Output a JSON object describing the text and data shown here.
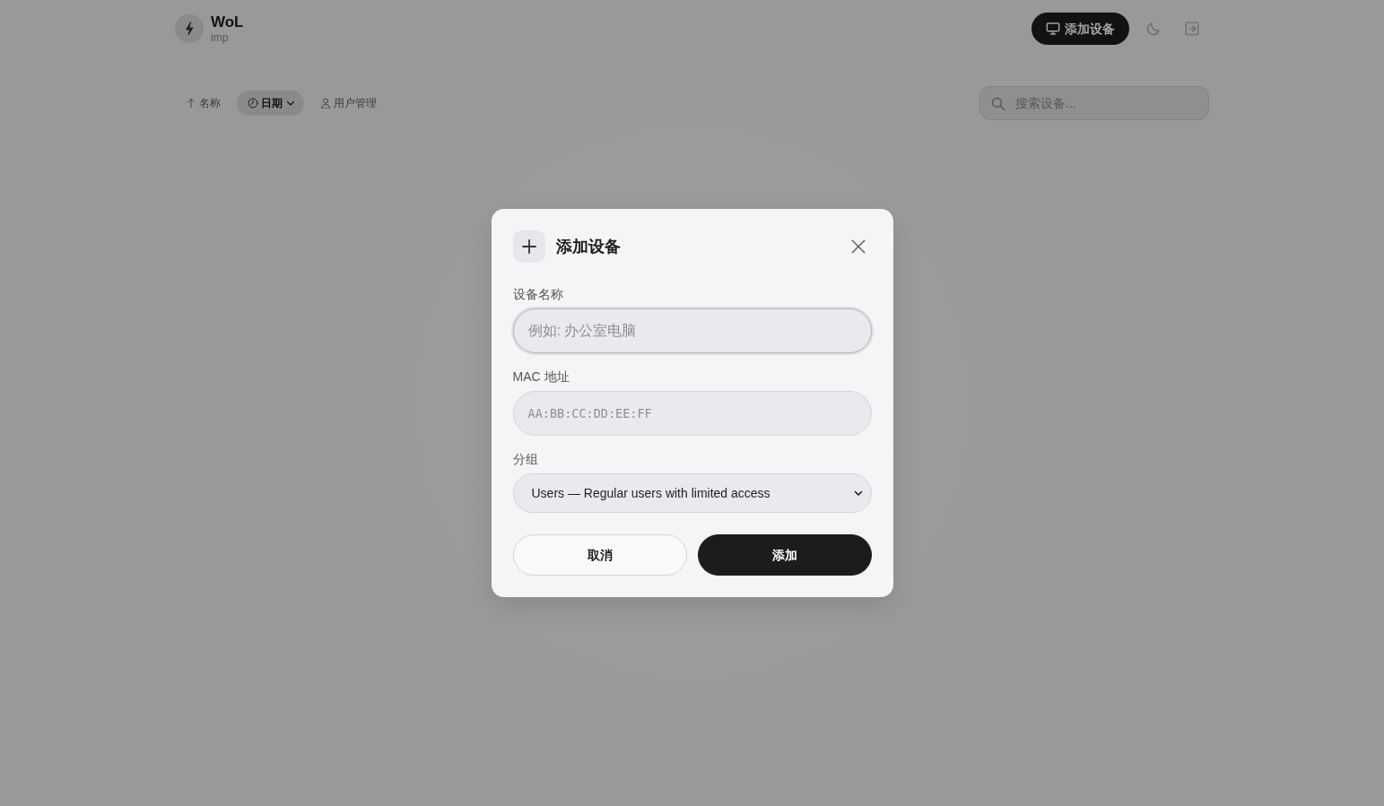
{
  "header": {
    "app_name": "WoL",
    "user": "imp",
    "add_device_button": "添加设备"
  },
  "toolbar": {
    "items": [
      {
        "kind": "name",
        "label": "名称",
        "selected": false
      },
      {
        "kind": "date",
        "label": "日期",
        "selected": true
      },
      {
        "kind": "users",
        "label": "用户管理",
        "selected": false
      }
    ],
    "search": {
      "placeholder": "搜索设备..."
    }
  },
  "dialog": {
    "title": "添加设备",
    "fields": [
      {
        "kind": "text",
        "label": "设备名称",
        "placeholder": "例如: 办公室电脑",
        "focused": true
      },
      {
        "kind": "mac",
        "label": "MAC 地址",
        "placeholder": "AA:BB:CC:DD:EE:FF",
        "focused": false
      },
      {
        "kind": "select",
        "label": "分组",
        "value": "Users — Regular users with limited access",
        "focused": false
      }
    ],
    "buttons": [
      {
        "kind": "secondary",
        "label": "取消"
      },
      {
        "kind": "primary",
        "label": "添加"
      }
    ]
  }
}
